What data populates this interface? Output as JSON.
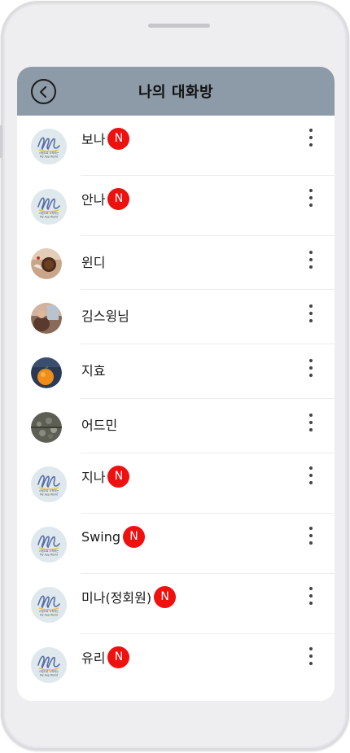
{
  "header": {
    "title": "나의 대화방"
  },
  "badge_text": "N",
  "colors": {
    "header_bg": "#8d9aa7",
    "badge_bg": "#ef1010",
    "frame": "#eeeef1"
  },
  "logo": {
    "line1": "스템으로 시작하는",
    "line2": "My App World"
  },
  "rooms": [
    {
      "name": "보나",
      "new": true,
      "avatar": "app-logo"
    },
    {
      "name": "안나",
      "new": true,
      "avatar": "app-logo"
    },
    {
      "name": "윈디",
      "new": false,
      "avatar": "coffee-photo"
    },
    {
      "name": "김스윙님",
      "new": false,
      "avatar": "person-photo"
    },
    {
      "name": "지효",
      "new": false,
      "avatar": "orange-photo"
    },
    {
      "name": "어드민",
      "new": false,
      "avatar": "aerial-photo"
    },
    {
      "name": "지나",
      "new": true,
      "avatar": "app-logo"
    },
    {
      "name": "Swing",
      "new": true,
      "avatar": "app-logo"
    },
    {
      "name": "미나(정회원)",
      "new": true,
      "avatar": "app-logo"
    },
    {
      "name": "유리",
      "new": true,
      "avatar": "app-logo"
    }
  ]
}
